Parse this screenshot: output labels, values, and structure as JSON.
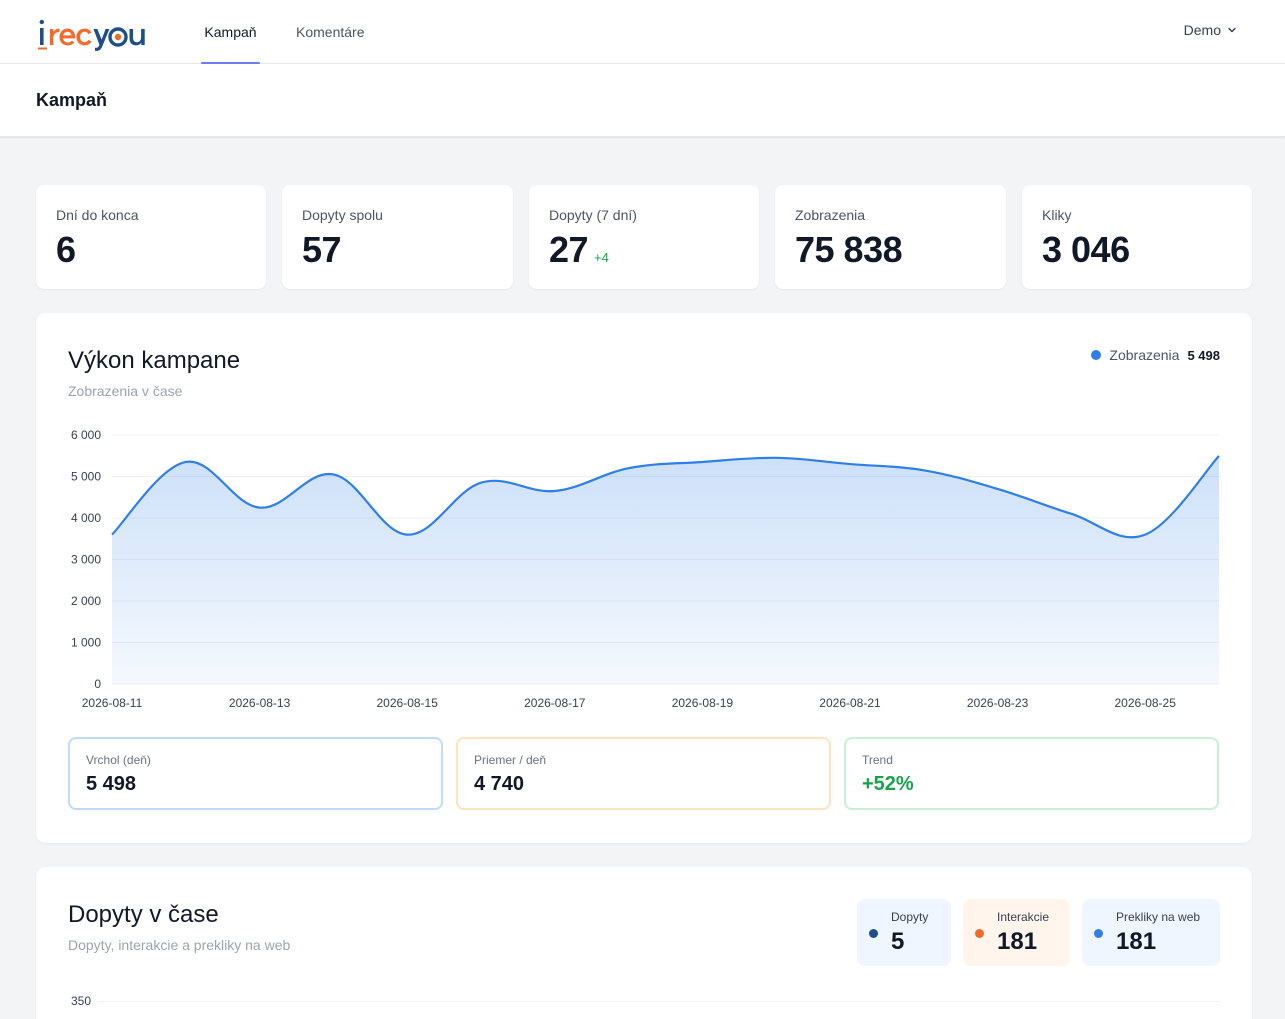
{
  "brand": {
    "logo_text": "irecyou"
  },
  "nav": {
    "tabs": [
      {
        "label": "Kampaň",
        "active": true
      },
      {
        "label": "Komentáre",
        "active": false
      }
    ],
    "user": "Demo"
  },
  "page": {
    "title": "Kampaň"
  },
  "stats": [
    {
      "label": "Dní do konca",
      "value": "6"
    },
    {
      "label": "Dopyty spolu",
      "value": "57"
    },
    {
      "label": "Dopyty (7 dní)",
      "value": "27",
      "delta": "+4"
    },
    {
      "label": "Zobrazenia",
      "value": "75 838"
    },
    {
      "label": "Kliky",
      "value": "3 046"
    }
  ],
  "performance": {
    "title": "Výkon kampane",
    "subtitle": "Zobrazenia v čase",
    "legend": {
      "label": "Zobrazenia",
      "value": "5 498",
      "color": "#2f7fe8"
    },
    "metrics": [
      {
        "label": "Vrchol (deň)",
        "value": "5 498",
        "color": "#bfdbfe"
      },
      {
        "label": "Priemer / deň",
        "value": "4 740",
        "color": "#fde3c0"
      },
      {
        "label": "Trend",
        "value": "+52%",
        "color": "#c8f0d4"
      }
    ]
  },
  "chart_data": {
    "type": "area",
    "title": "Výkon kampane",
    "subtitle": "Zobrazenia v čase",
    "xlabel": "",
    "ylabel": "",
    "ylim": [
      0,
      6000
    ],
    "yticks": [
      0,
      1000,
      2000,
      3000,
      4000,
      5000,
      6000
    ],
    "ytick_labels": [
      "0",
      "1 000",
      "2 000",
      "3 000",
      "4 000",
      "5 000",
      "6 000"
    ],
    "xtick_labels": [
      "2026-08-11",
      "2026-08-13",
      "2026-08-15",
      "2026-08-17",
      "2026-08-19",
      "2026-08-21",
      "2026-08-23",
      "2026-08-25"
    ],
    "grid": true,
    "legend_position": "top-right",
    "series": [
      {
        "name": "Zobrazenia",
        "color": "#2f7fe8",
        "x": [
          "2026-08-11",
          "2026-08-12",
          "2026-08-13",
          "2026-08-14",
          "2026-08-15",
          "2026-08-16",
          "2026-08-17",
          "2026-08-18",
          "2026-08-19",
          "2026-08-20",
          "2026-08-21",
          "2026-08-22",
          "2026-08-23",
          "2026-08-24",
          "2026-08-25",
          "2026-08-26"
        ],
        "values": [
          3600,
          5350,
          4250,
          5050,
          3600,
          4850,
          4650,
          5200,
          5350,
          5450,
          5300,
          5150,
          4700,
          4100,
          3600,
          5498
        ]
      }
    ]
  },
  "inquiries": {
    "title": "Dopyty v čase",
    "subtitle": "Dopyty, interakcie a prekliky na web",
    "chips": [
      {
        "label": "Dopyty",
        "value": "5",
        "dot": "#1e4f8a",
        "bg": "#eff6ff"
      },
      {
        "label": "Interakcie",
        "value": "181",
        "dot": "#f26b2a",
        "bg": "#fff5ec"
      },
      {
        "label": "Prekliky na web",
        "value": "181",
        "dot": "#2f7fe8",
        "bg": "#eff6ff"
      }
    ],
    "axis_top_label": "350"
  }
}
